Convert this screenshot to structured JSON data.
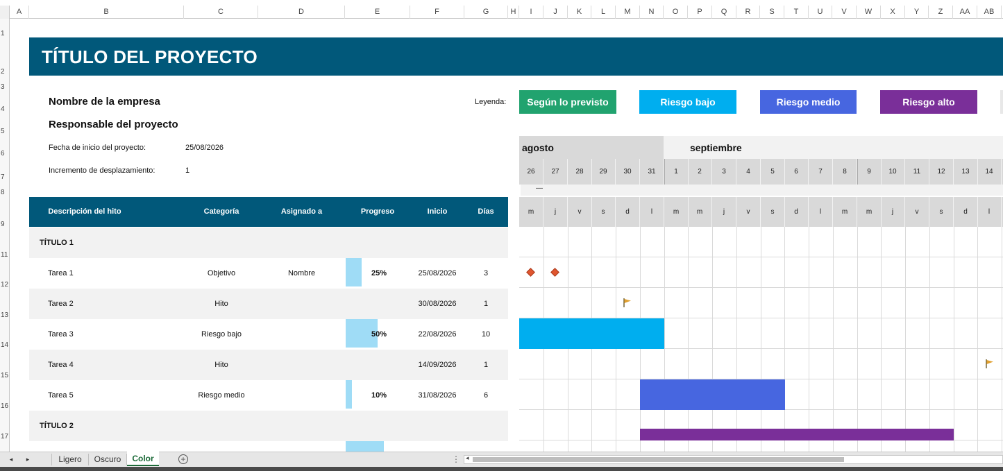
{
  "column_headers": [
    "A",
    "B",
    "C",
    "D",
    "E",
    "F",
    "G",
    "H",
    "I",
    "J",
    "K",
    "L",
    "M",
    "N",
    "O",
    "P",
    "Q",
    "R",
    "S",
    "T",
    "U",
    "V",
    "W",
    "X",
    "Y",
    "Z",
    "AA",
    "AB"
  ],
  "row_headers": [
    "1",
    "2",
    "3",
    "4",
    "5",
    "6",
    "7",
    "8",
    "9",
    "11",
    "12",
    "13",
    "14",
    "15",
    "16",
    "17"
  ],
  "project": {
    "title": "TÍTULO DEL PROYECTO",
    "company": "Nombre de la empresa",
    "manager": "Responsable del proyecto",
    "start_label": "Fecha de inicio del proyecto:",
    "start_value": "25/08/2026",
    "increment_label": "Incremento de desplazamiento:",
    "increment_value": "1"
  },
  "legend": {
    "label": "Leyenda:",
    "items": [
      {
        "label": "Según lo previsto",
        "color": "#21a36f"
      },
      {
        "label": "Riesgo bajo",
        "color": "#00aeef"
      },
      {
        "label": "Riesgo medio",
        "color": "#4766e0"
      },
      {
        "label": "Riesgo alto",
        "color": "#7a2f99"
      }
    ]
  },
  "table": {
    "headers": [
      "Descripción del hito",
      "Categoría",
      "Asignado a",
      "Progreso",
      "Inicio",
      "Días"
    ],
    "rows": [
      {
        "kind": "title",
        "desc": "TÍTULO 1"
      },
      {
        "kind": "task",
        "desc": "Tarea 1",
        "category": "Objetivo",
        "assigned": "Nombre",
        "progress": "25%",
        "progress_value": 0.25,
        "start": "25/08/2026",
        "days": "3"
      },
      {
        "kind": "task",
        "desc": "Tarea 2",
        "category": "Hito",
        "assigned": "",
        "progress": "",
        "progress_value": 0,
        "start": "30/08/2026",
        "days": "1"
      },
      {
        "kind": "task",
        "desc": "Tarea 3",
        "category": "Riesgo bajo",
        "assigned": "",
        "progress": "50%",
        "progress_value": 0.5,
        "start": "22/08/2026",
        "days": "10"
      },
      {
        "kind": "task",
        "desc": "Tarea 4",
        "category": "Hito",
        "assigned": "",
        "progress": "",
        "progress_value": 0,
        "start": "14/09/2026",
        "days": "1"
      },
      {
        "kind": "task",
        "desc": "Tarea 5",
        "category": "Riesgo medio",
        "assigned": "",
        "progress": "10%",
        "progress_value": 0.1,
        "start": "31/08/2026",
        "days": "6"
      },
      {
        "kind": "title",
        "desc": "TÍTULO 2"
      }
    ]
  },
  "gantt": {
    "months": [
      "agosto",
      "septiembre"
    ],
    "days": [
      "26",
      "27",
      "28",
      "29",
      "30",
      "31",
      "1",
      "2",
      "3",
      "4",
      "5",
      "6",
      "7",
      "8",
      "9",
      "10",
      "11",
      "12",
      "13",
      "14"
    ],
    "weekdays": [
      "m",
      "j",
      "v",
      "s",
      "d",
      "l",
      "m",
      "m",
      "j",
      "v",
      "s",
      "d",
      "l",
      "m",
      "m",
      "j",
      "v",
      "s",
      "d",
      "l"
    ],
    "scroll_marker": "—"
  },
  "sheet_tabs": [
    "Ligero",
    "Oscuro",
    "Color"
  ],
  "active_tab": "Color",
  "colors": {
    "header_blue": "#01587a",
    "on_track": "#21a36f",
    "low_risk": "#00aeef",
    "medium_risk": "#4766e0",
    "high_risk": "#7a2f99",
    "progress_fill": "#9fdcf6",
    "milestone_diamond": "#e0562f",
    "flag": "#e0a030"
  },
  "icons": {
    "milestone": "diamond-icon",
    "flag": "flag-icon",
    "add_sheet": "plus-circle-icon",
    "nav_left": "chevron-left-icon",
    "nav_right": "chevron-right-icon"
  }
}
